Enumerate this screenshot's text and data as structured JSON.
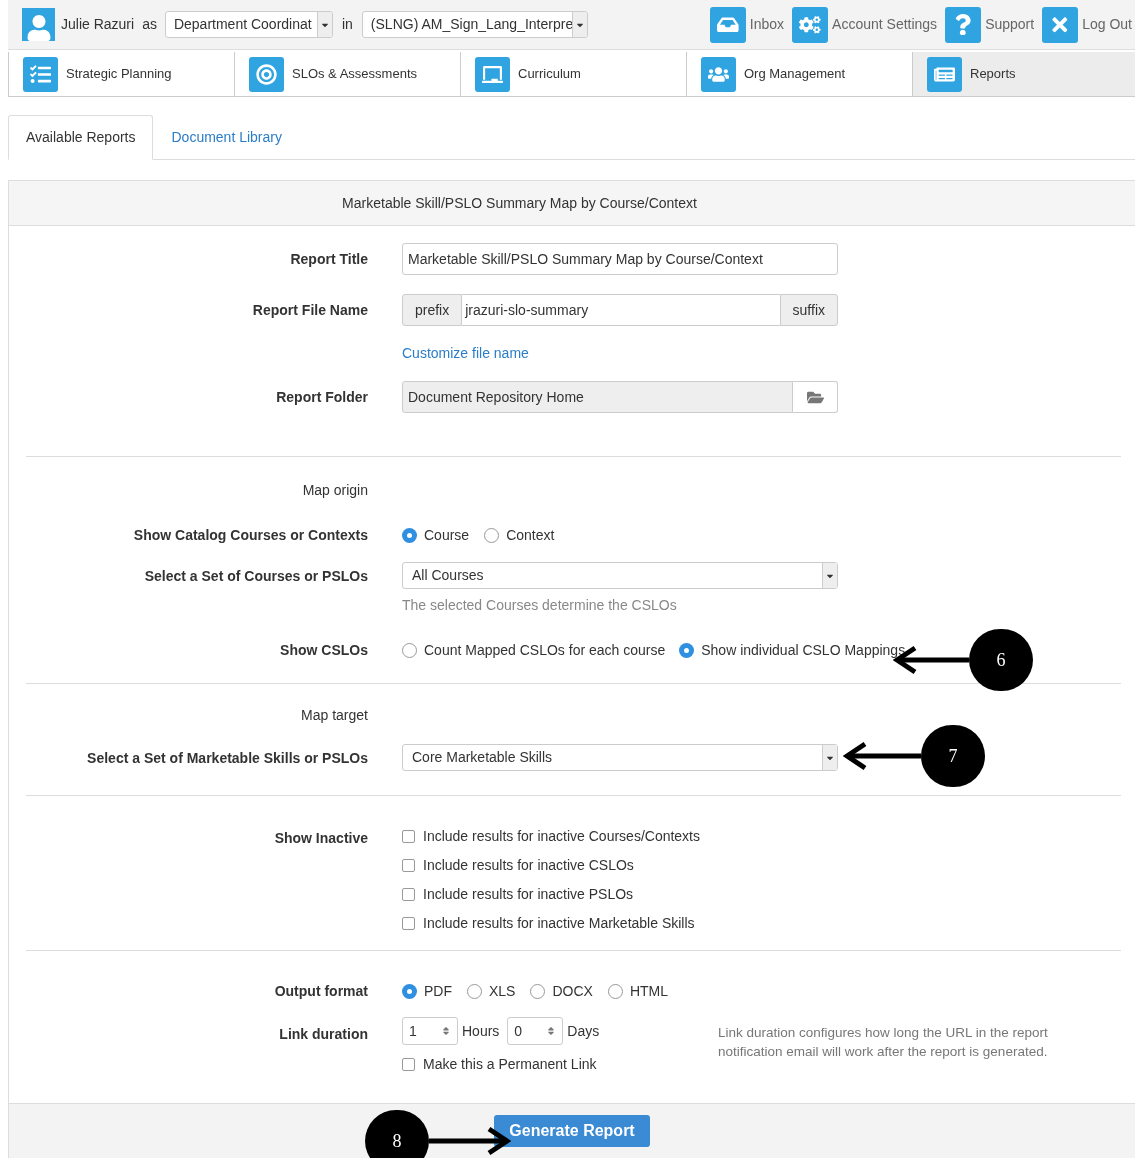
{
  "header": {
    "user": "Julie Razuri",
    "as_label": "as",
    "role": "Department Coordinat",
    "in_label": "in",
    "unit": "(SLNG) AM_Sign_Lang_Interpre"
  },
  "top_links": [
    {
      "label": "Inbox"
    },
    {
      "label": "Account Settings"
    },
    {
      "label": "Support"
    },
    {
      "label": "Log Out"
    }
  ],
  "modules": [
    {
      "label": "Strategic Planning",
      "selected": false
    },
    {
      "label": "SLOs & Assessments",
      "selected": false
    },
    {
      "label": "Curriculum",
      "selected": false
    },
    {
      "label": "Org Management",
      "selected": false
    },
    {
      "label": "Reports",
      "selected": true
    }
  ],
  "subtabs": [
    {
      "label": "Available Reports",
      "selected": true
    },
    {
      "label": "Document Library",
      "selected": false
    }
  ],
  "report": {
    "heading": "Marketable Skill/PSLO Summary Map by Course/Context",
    "report_title": {
      "label": "Report Title",
      "value": "Marketable Skill/PSLO Summary Map by Course/Context"
    },
    "file_name": {
      "label": "Report File Name",
      "prefix": "prefix",
      "value": "jrazuri-slo-summary",
      "suffix": "suffix"
    },
    "customize_link": "Customize file name",
    "folder": {
      "label": "Report Folder",
      "value": "Document Repository Home"
    },
    "map_origin": "Map origin",
    "show_catalog": {
      "label": "Show Catalog Courses or Contexts",
      "options": [
        {
          "label": "Course",
          "selected": true
        },
        {
          "label": "Context",
          "selected": false
        }
      ]
    },
    "course_set": {
      "label": "Select a Set of Courses or PSLOs",
      "value": "All Courses",
      "hint": "The selected Courses determine the CSLOs"
    },
    "show_cslos": {
      "label": "Show CSLOs",
      "options": [
        {
          "label": "Count Mapped CSLOs for each course",
          "selected": false
        },
        {
          "label": "Show individual CSLO Mappings",
          "selected": true
        }
      ]
    },
    "map_target": "Map target",
    "skill_set": {
      "label": "Select a Set of Marketable Skills or PSLOs",
      "value": "Core Marketable Skills"
    },
    "show_inactive": {
      "label": "Show Inactive",
      "options": [
        {
          "label": "Include results for inactive Courses/Contexts",
          "checked": false
        },
        {
          "label": "Include results for inactive CSLOs",
          "checked": false
        },
        {
          "label": "Include results for inactive PSLOs",
          "checked": false
        },
        {
          "label": "Include results for inactive Marketable Skills",
          "checked": false
        }
      ]
    },
    "output_format": {
      "label": "Output format",
      "options": [
        {
          "label": "PDF",
          "selected": true
        },
        {
          "label": "XLS",
          "selected": false
        },
        {
          "label": "DOCX",
          "selected": false
        },
        {
          "label": "HTML",
          "selected": false
        }
      ]
    },
    "link_duration": {
      "label": "Link duration",
      "hours": "1",
      "hours_label": "Hours",
      "days": "0",
      "days_label": "Days",
      "permanent": {
        "label": "Make this a Permanent Link",
        "checked": false
      },
      "help": "Link duration configures how long the URL in the report notification email will work after the report is generated."
    },
    "generate_button": "Generate Report"
  },
  "callouts": [
    "6",
    "7",
    "8"
  ]
}
